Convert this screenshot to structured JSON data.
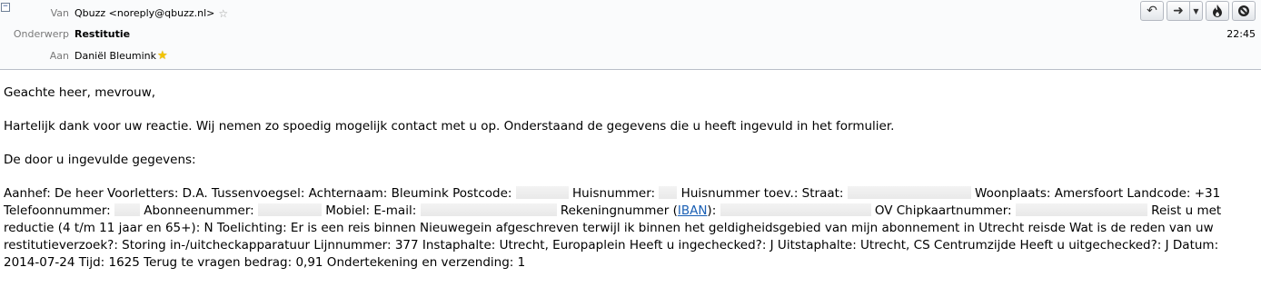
{
  "header": {
    "from_label": "Van",
    "from_value": "Qbuzz <noreply@qbuzz.nl>",
    "subject_label": "Onderwerp",
    "subject_value": "Restitutie",
    "to_label": "Aan",
    "to_value": "Daniël Bleumink",
    "time": "22:45",
    "collapse_symbol": "−",
    "star_outline": "☆",
    "star_filled": "★"
  },
  "toolbar": {
    "reply_icon": "reply-icon",
    "forward_icon": "forward-icon",
    "more_icon": "chevron-down-icon",
    "junk_icon": "junk-flame-icon",
    "delete_icon": "delete-icon",
    "reply_glyph": "↶",
    "forward_glyph": "➜",
    "dropdown_glyph": "▼",
    "junk_glyph": "🔥",
    "delete_glyph": "⊘"
  },
  "body": {
    "greeting": "Geachte heer, mevrouw,",
    "intro": "Hartelijk dank voor uw reactie. Wij nemen zo spoedig mogelijk contact met u op. Onderstaand de gegevens die u heeft ingevuld in het formulier.",
    "data_heading": "De door u ingevulde gegevens:",
    "details": {
      "p1": "Aanhef: De heer Voorletters: D.A. Tussenvoegsel: Achternaam: Bleumink Postcode: ",
      "p2": " Huisnummer: ",
      "p3": " Huisnummer toev.: Straat: ",
      "p4": " Woonplaats: Amersfoort Landcode: +31 Telefoonnummer: ",
      "p5": " Abonneenummer: ",
      "p6": " Mobiel: E-mail: ",
      "p7": " Rekeningnummer (",
      "iban_link": "IBAN",
      "p8": "): ",
      "p9": " OV Chipkaartnummer: ",
      "p10": " Reist u met reductie (4 t/m 11 jaar en 65+): N Toelichting: Er is een reis binnen Nieuwegein afgeschreven terwijl ik binnen het geldigheidsgebied van mijn abonnement in Utrecht reisde Wat is de reden van uw restitutieverzoek?: Storing in-/uitcheckapparatuur Lijnnummer: 377 Instaphalte: Utrecht, Europaplein Heeft u ingechecked?: J Uitstaphalte: Utrecht, CS Centrumzijde Heeft u uitgechecked?: J Datum: 2014-07-24 Tijd: 1625 Terug te vragen bedrag: 0,91 Ondertekening en verzending: 1"
    }
  }
}
